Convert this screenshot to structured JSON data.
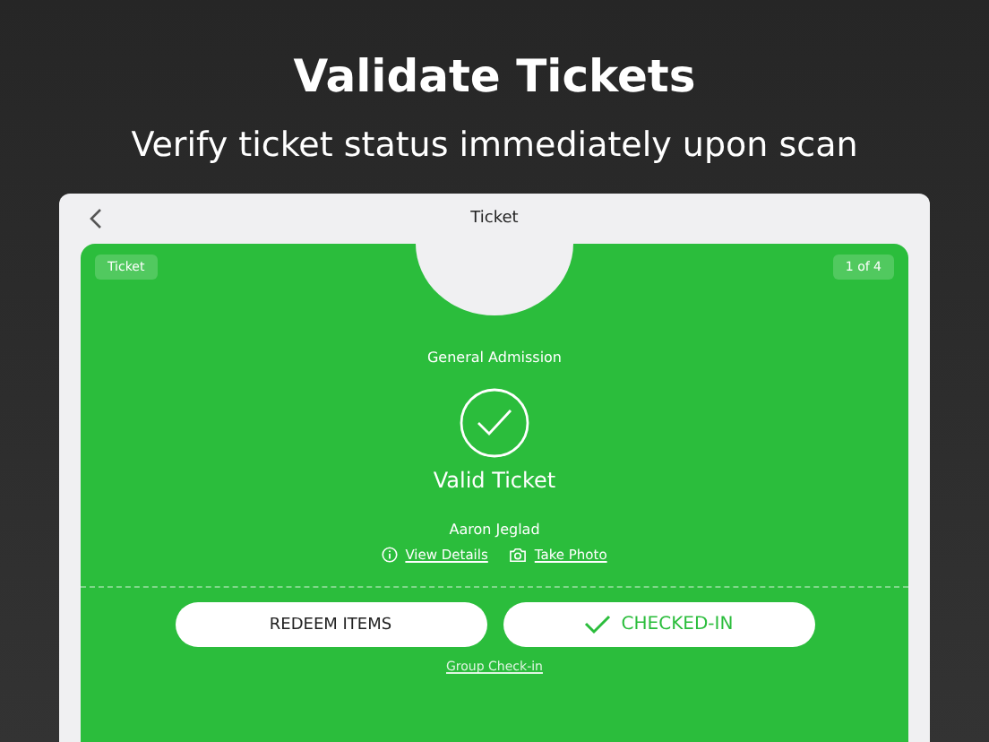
{
  "headline": "Validate Tickets",
  "subheadline": "Verify ticket status immediately upon scan",
  "nav": {
    "title": "Ticket"
  },
  "ticket": {
    "type_badge": "Ticket",
    "count_badge": "1 of 4",
    "admission": "General Admission",
    "valid": true,
    "status_text": "Valid Ticket",
    "holder": "Aaron Jeglad",
    "links": [
      {
        "kind": "info",
        "label": "View Details"
      },
      {
        "kind": "camera",
        "label": "Take Photo"
      }
    ],
    "buttons": [
      {
        "kind": "plain",
        "label": "REDEEM ITEMS"
      },
      {
        "kind": "checked",
        "label": "CHECKED-IN"
      }
    ],
    "group_link": "Group Check-in"
  }
}
